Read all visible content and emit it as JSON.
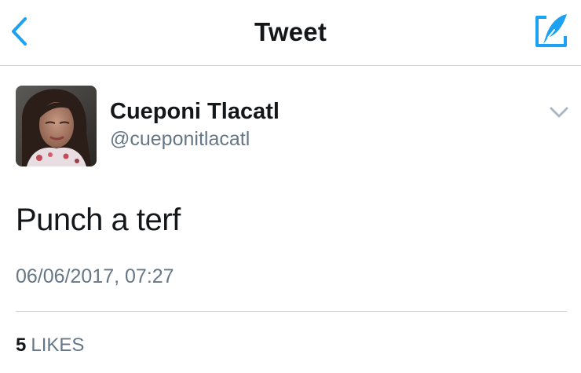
{
  "nav": {
    "title": "Tweet",
    "back_icon": "chevron-left-icon",
    "compose_icon": "compose-feather-icon"
  },
  "tweet": {
    "author": {
      "display_name": "Cueponi Tlacatl",
      "handle": "@cueponitlacatl"
    },
    "text": "Punch a terf",
    "timestamp": "06/06/2017, 07:27",
    "likes_count": "5",
    "likes_label": "LIKES"
  },
  "colors": {
    "accent": "#1da1f2",
    "text_primary": "#14171a",
    "text_secondary": "#657786",
    "divider": "#cfd3d6",
    "caret": "#aab8c2"
  }
}
